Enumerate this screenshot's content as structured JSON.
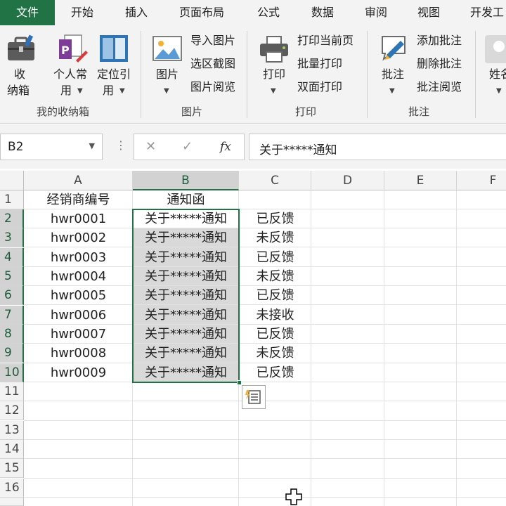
{
  "tabs": [
    "文件",
    "开始",
    "插入",
    "页面布局",
    "公式",
    "数据",
    "审阅",
    "视图",
    "开发工"
  ],
  "ribbon": {
    "groups": {
      "storage": {
        "label": "我的收纳箱",
        "box_line1": "收",
        "box_line2": "纳箱",
        "personal_line1": "个人常",
        "personal_line2": "用",
        "locate_line1": "定位引",
        "locate_line2": "用"
      },
      "picture": {
        "label": "图片",
        "main": "图片",
        "import": "导入图片",
        "region_capture": "选区截图",
        "viewer": "图片阅览"
      },
      "print": {
        "label": "打印",
        "main": "打印",
        "current_page": "打印当前页",
        "batch": "批量打印",
        "duplex": "双面打印"
      },
      "comment": {
        "label": "批注",
        "main": "批注",
        "add": "添加批注",
        "delete": "删除批注",
        "browse": "批注阅览"
      },
      "name": {
        "main": "姓名"
      }
    }
  },
  "formula_bar": {
    "name_box": "B2",
    "fx": "fx",
    "content": "关于*****通知"
  },
  "sheet": {
    "columns": [
      "A",
      "B",
      "C",
      "D",
      "E",
      "F"
    ],
    "row_numbers": [
      "1",
      "2",
      "3",
      "4",
      "5",
      "6",
      "7",
      "8",
      "9",
      "10",
      "11",
      "12",
      "13",
      "14",
      "15",
      "16"
    ],
    "header": {
      "a": "经销商编号",
      "b": "通知函"
    },
    "rows": [
      {
        "a": "hwr0001",
        "b": "关于*****通知",
        "c": "已反馈"
      },
      {
        "a": "hwr0002",
        "b": "关于*****通知",
        "c": "未反馈"
      },
      {
        "a": "hwr0003",
        "b": "关于*****通知",
        "c": "已反馈"
      },
      {
        "a": "hwr0004",
        "b": "关于*****通知",
        "c": "未反馈"
      },
      {
        "a": "hwr0005",
        "b": "关于*****通知",
        "c": "已反馈"
      },
      {
        "a": "hwr0006",
        "b": "关于*****通知",
        "c": "未接收"
      },
      {
        "a": "hwr0007",
        "b": "关于*****通知",
        "c": "已反馈"
      },
      {
        "a": "hwr0008",
        "b": "关于*****通知",
        "c": "未反馈"
      },
      {
        "a": "hwr0009",
        "b": "关于*****通知",
        "c": "已反馈"
      }
    ]
  },
  "colors": {
    "accent": "#217346",
    "selection_fill": "#d9d9d9"
  }
}
